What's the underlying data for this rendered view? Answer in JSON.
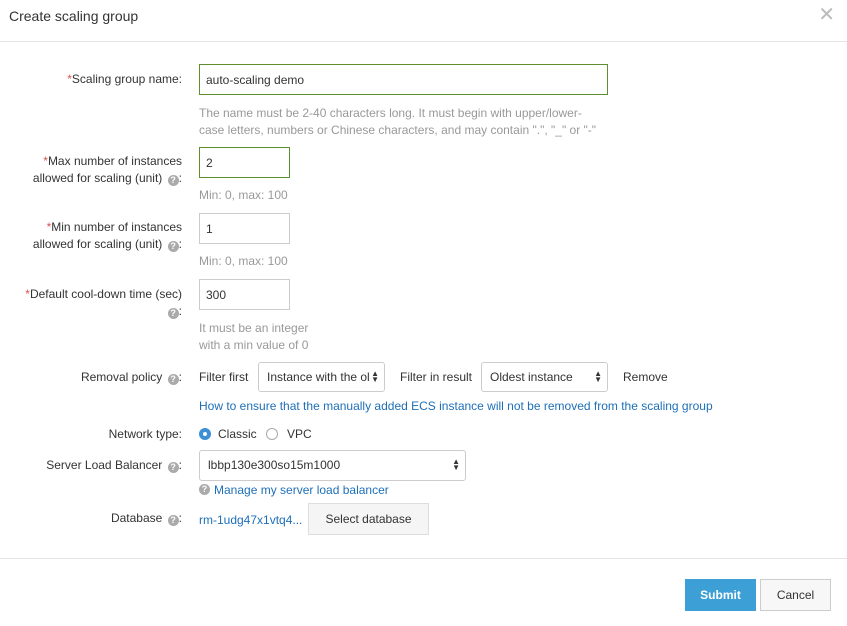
{
  "dialog": {
    "title": "Create scaling group",
    "close_icon": "close-icon"
  },
  "form": {
    "name": {
      "required_mark": "*",
      "label": "Scaling group name:",
      "value": "auto-scaling demo",
      "hint_line1": "The name must be 2-40 characters long. It must begin with upper/lower-",
      "hint_line2": "case letters, numbers or Chinese characters, and may contain \".\", \"_\" or \"-\""
    },
    "max_instances": {
      "required_mark": "*",
      "label_line1": "Max number of instances",
      "label_line2": "allowed for scaling (unit)",
      "colon": ":",
      "value": "2",
      "hint": "Min: 0, max: 100"
    },
    "min_instances": {
      "required_mark": "*",
      "label_line1": "Min number of instances",
      "label_line2": "allowed for scaling (unit)",
      "colon": ":",
      "value": "1",
      "hint": "Min: 0, max: 100"
    },
    "cooldown": {
      "required_mark": "*",
      "label_line1": "Default cool-down time (sec)",
      "colon": ":",
      "value": "300",
      "hint_line1": "It must be an integer",
      "hint_line2": "with a min value of 0"
    },
    "removal_policy": {
      "label": "Removal policy",
      "colon": ":",
      "filter_first_label": "Filter first",
      "filter_first_value": "Instance with the ol",
      "filter_result_label": "Filter in result",
      "filter_result_value": "Oldest instance",
      "remove_label": "Remove",
      "help_link": "How to ensure that the manually added ECS instance will not be removed from the scaling group"
    },
    "network_type": {
      "label": "Network type:",
      "options": [
        "Classic",
        "VPC"
      ],
      "selected": "Classic"
    },
    "slb": {
      "label": "Server Load Balancer",
      "colon": ":",
      "value": "lbbp130e300so15m1000",
      "manage_link": "Manage my server load balancer"
    },
    "database": {
      "label": "Database",
      "colon": ":",
      "value": "rm-1udg47x1vtq4...",
      "select_button": "Select database"
    }
  },
  "footer": {
    "submit": "Submit",
    "cancel": "Cancel"
  },
  "colors": {
    "accent": "#3c9fd6",
    "link": "#1e6fb8",
    "required": "#d9534f",
    "valid_border": "#5e8f2e"
  }
}
